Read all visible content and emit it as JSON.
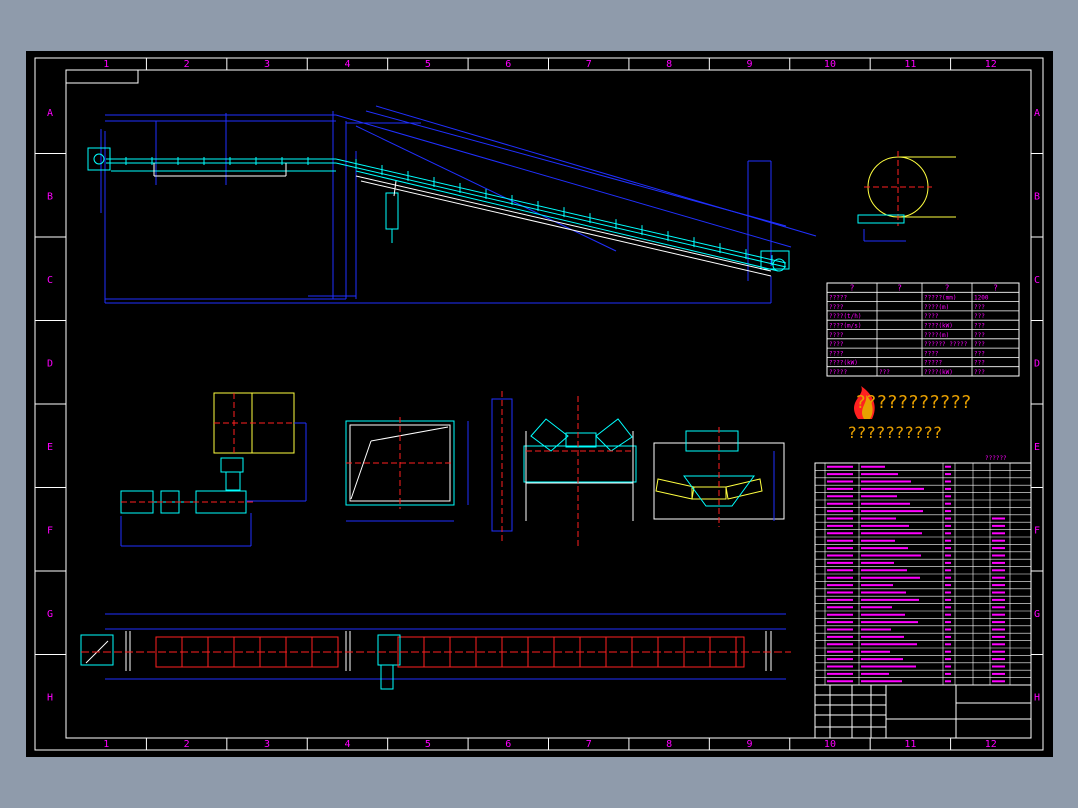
{
  "colors": {
    "border": "#ffffff",
    "blue": "#2030ff",
    "cyan": "#00ffff",
    "red": "#ff2020",
    "magenta": "#ff00ff",
    "yellow": "#ffff40",
    "green": "#30ff30",
    "logo": "#e8a000"
  },
  "grid": {
    "columns": [
      "1",
      "2",
      "3",
      "4",
      "5",
      "6",
      "7",
      "8",
      "9",
      "10",
      "11",
      "12"
    ],
    "rows": [
      "A",
      "B",
      "C",
      "D",
      "E",
      "F",
      "G",
      "H"
    ]
  },
  "parameter_table": {
    "header": [
      "?",
      "?",
      "?",
      "?"
    ],
    "rows": [
      [
        "?????",
        "",
        "?????(mm)",
        "1200"
      ],
      [
        "????",
        "",
        "????(m)",
        "???"
      ],
      [
        "????(t/h)",
        "",
        "????",
        "???"
      ],
      [
        "????(m/s)",
        "",
        "????(kW)",
        "???"
      ],
      [
        "????",
        "",
        "????(m)",
        "???"
      ],
      [
        "????",
        "",
        "?????? ?????",
        "???"
      ],
      [
        "????",
        "",
        "????",
        "???"
      ],
      [
        "????(kW)",
        "",
        "?????",
        "???"
      ],
      [
        "?????",
        "???",
        "????(kW)",
        "???"
      ]
    ]
  },
  "logo": {
    "line1": "???????????",
    "line2": "??????????"
  },
  "parts_list": {
    "heading": "??????",
    "row_count": 30
  }
}
